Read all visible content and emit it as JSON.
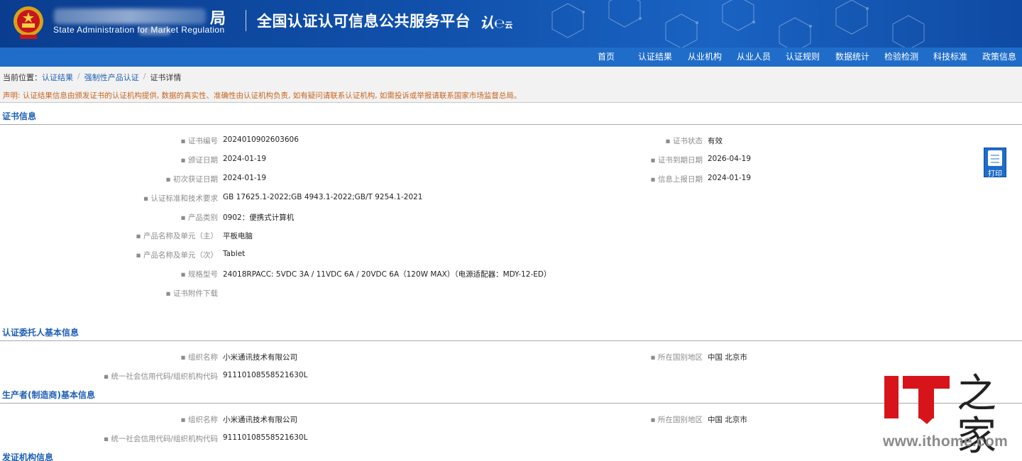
{
  "header": {
    "agency_cn_visible": "局",
    "agency_en": "State Administration  for  Market Regulation",
    "platform_title": "全国认证认可信息公共服务平台",
    "cloud_logo_main": "认",
    "cloud_logo_sub": "云"
  },
  "nav": {
    "items": [
      {
        "label": "首页"
      },
      {
        "label": "认证结果"
      },
      {
        "label": "从业机构"
      },
      {
        "label": "从业人员"
      },
      {
        "label": "认证规则"
      },
      {
        "label": "数据统计"
      },
      {
        "label": "检验检测"
      },
      {
        "label": "科技标准"
      },
      {
        "label": "政策信息"
      }
    ]
  },
  "breadcrumb": {
    "prefix": "当前位置：",
    "items": [
      "认证结果",
      "强制性产品认证",
      "证书详情"
    ],
    "separator": "/"
  },
  "notice": "声明: 认证结果信息由颁发证书的认证机构提供, 数据的真实性、准确性由认证机构负责, 如有疑问请联系认证机构, 如需投诉或举报请联系国家市场监督总局。",
  "cert_section": {
    "title": "证书信息",
    "cert_no_label": "证书编号",
    "cert_no": "2024010902603606",
    "status_label": "证书状态",
    "status": "有效",
    "issue_date_label": "颁证日期",
    "issue_date": "2024-01-19",
    "expire_date_label": "证书到期日期",
    "expire_date": "2026-04-19",
    "first_date_label": "初次获证日期",
    "first_date": "2024-01-19",
    "report_date_label": "信息上报日期",
    "report_date": "2024-01-19",
    "standard_label": "认证标准和技术要求",
    "standard": "GB 17625.1-2022;GB 4943.1-2022;GB/T 9254.1-2021",
    "category_label": "产品类别",
    "category": "0902：便携式计算机",
    "product_main_label": "产品名称及单元（主）",
    "product_main": "平板电脑",
    "product_sub_label": "产品名称及单元（次）",
    "product_sub": "Tablet",
    "model_label": "规格型号",
    "model": "24018RPACC: 5VDC 3A / 11VDC 6A / 20VDC 6A（120W MAX）（电源适配器：MDY-12-ED）",
    "attachment_label": "证书附件下载",
    "print_label": "打印"
  },
  "client_section": {
    "title": "认证委托人基本信息",
    "org_label": "组织名称",
    "org": "小米通讯技术有限公司",
    "region_label": "所在国别地区",
    "region": "中国 北京市",
    "credit_label": "统一社会信用代码/组织机构代码",
    "credit": "91110108558521630L"
  },
  "maker_section": {
    "title": "生产者(制造商)基本信息",
    "org_label": "组织名称",
    "org": "小米通讯技术有限公司",
    "region_label": "所在国别地区",
    "region": "中国 北京市",
    "credit_label": "统一社会信用代码/组织机构代码",
    "credit": "91110108558521630L"
  },
  "issuer_section": {
    "title": "发证机构信息"
  },
  "watermark": {
    "brand": "IT",
    "script": "之家",
    "url": "www.ithome.com"
  }
}
